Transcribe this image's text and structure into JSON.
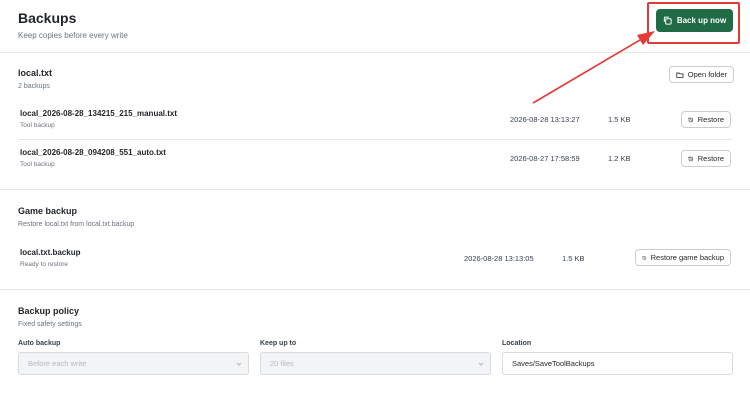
{
  "header": {
    "title": "Backups",
    "subtitle": "Keep copies before every write",
    "backup_now_label": "Back up now"
  },
  "local_section": {
    "title": "local.txt",
    "subtitle": "2 backups",
    "open_folder_label": "Open folder",
    "backups": [
      {
        "name": "local_2026-08-28_134215_215_manual.txt",
        "kind": "Tool backup",
        "date": "2026-08-28 13:13:27",
        "size": "1.5 KB",
        "action": "Restore"
      },
      {
        "name": "local_2026-08-28_094208_551_auto.txt",
        "kind": "Tool backup",
        "date": "2026-08-27 17:58:59",
        "size": "1.2 KB",
        "action": "Restore"
      }
    ]
  },
  "game_section": {
    "title": "Game backup",
    "subtitle": "Restore local.txt from local.txt.backup",
    "item": {
      "name": "local.txt.backup",
      "status": "Ready to restore",
      "date": "2026-08-28 13:13:05",
      "size": "1.5 KB",
      "action": "Restore game backup"
    }
  },
  "policy_section": {
    "title": "Backup policy",
    "subtitle": "Fixed safety settings",
    "auto_backup": {
      "label": "Auto backup",
      "value": "Before each write"
    },
    "keep_up_to": {
      "label": "Keep up to",
      "value": "20 files"
    },
    "location": {
      "label": "Location",
      "value": "Saves/SaveToolBackups"
    }
  },
  "colors": {
    "primary": "#1f6b45",
    "highlight": "#e53935"
  }
}
